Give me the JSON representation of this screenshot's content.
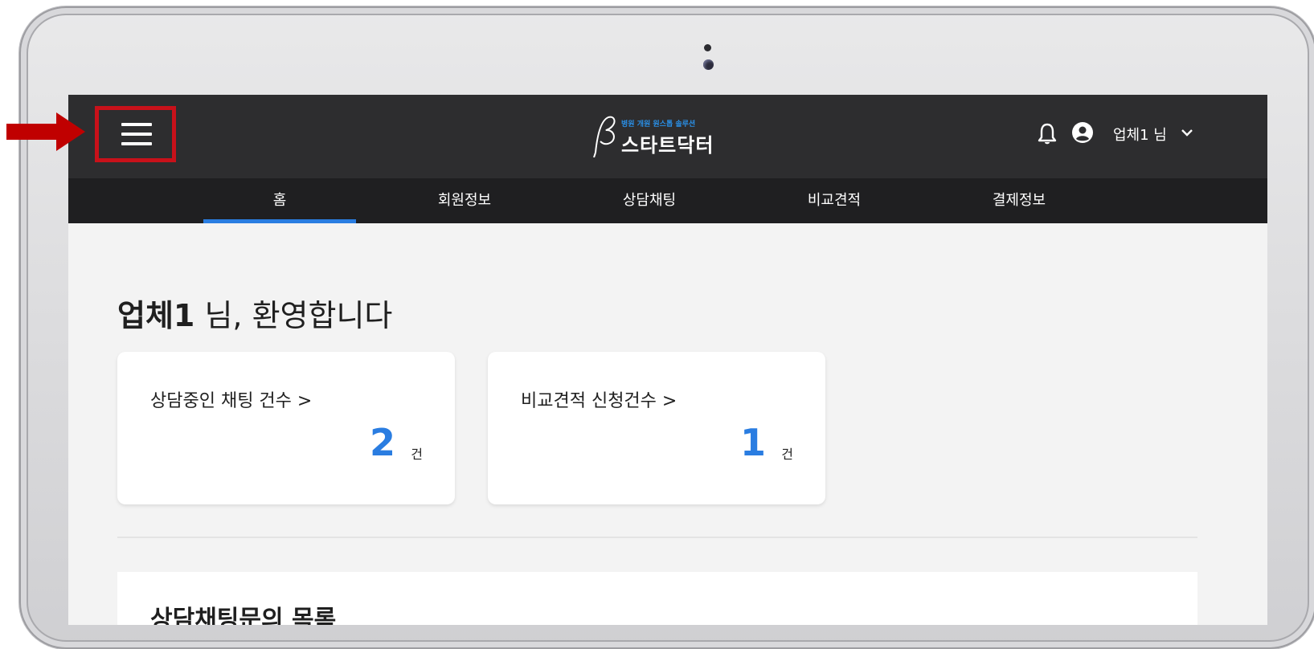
{
  "logo": {
    "tagline": "병원 개원 원스톱 솔루션",
    "name": "스타트닥터"
  },
  "header": {
    "user_label": "업체1 님"
  },
  "tabs": [
    {
      "label": "홈",
      "active": true
    },
    {
      "label": "회원정보",
      "active": false
    },
    {
      "label": "상담채팅",
      "active": false
    },
    {
      "label": "비교견적",
      "active": false
    },
    {
      "label": "결제정보",
      "active": false
    }
  ],
  "welcome": {
    "name": "업체1",
    "suffix": " 님, 환영합니다"
  },
  "cards": [
    {
      "title": "상담중인 채팅 건수 >",
      "value": "2",
      "unit": "건"
    },
    {
      "title": "비교견적 신청건수 >",
      "value": "1",
      "unit": "건"
    }
  ],
  "list": {
    "title": "상담채팅문의 목록"
  },
  "colors": {
    "accent": "#2a7de1",
    "highlight": "#c8111a",
    "header_bg": "#2d2d2f"
  },
  "icons": [
    "menu-icon",
    "bell-icon",
    "user-circle-icon",
    "chevron-down-icon",
    "red-arrow-icon"
  ]
}
